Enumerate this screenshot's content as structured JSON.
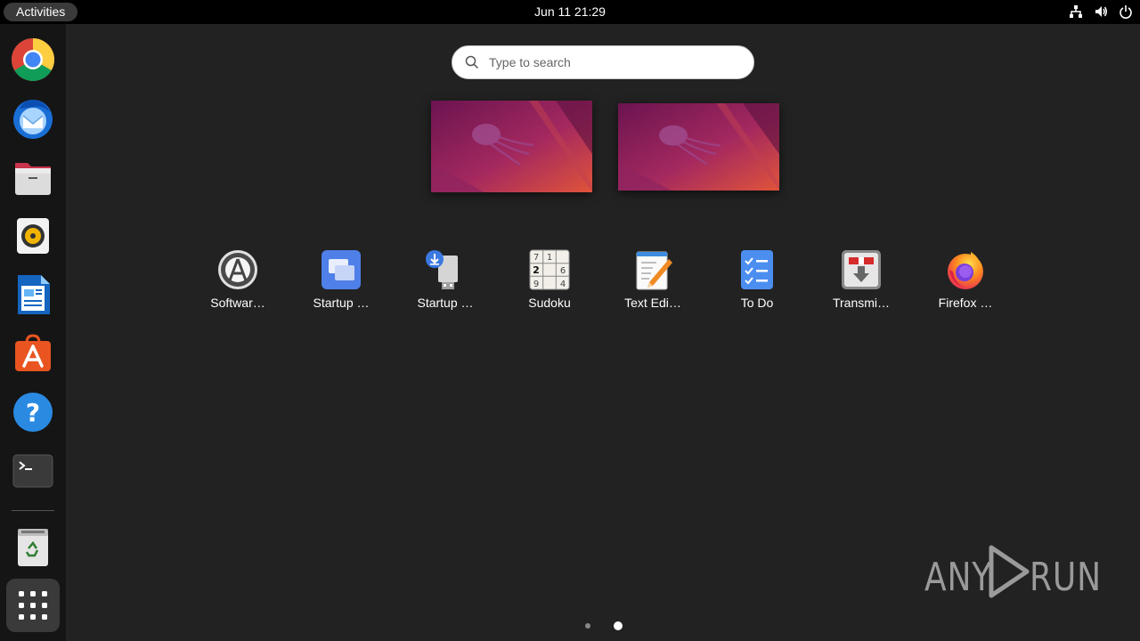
{
  "topbar": {
    "activities_label": "Activities",
    "clock": "Jun 11  21:29",
    "tray_icons": [
      "network-icon",
      "volume-icon",
      "power-icon"
    ]
  },
  "search": {
    "placeholder": "Type to search"
  },
  "dock": {
    "items": [
      {
        "name": "Google Chrome",
        "icon": "chrome-icon"
      },
      {
        "name": "Thunderbird Mail",
        "icon": "thunderbird-icon"
      },
      {
        "name": "Files",
        "icon": "files-icon"
      },
      {
        "name": "Rhythmbox",
        "icon": "rhythmbox-icon"
      },
      {
        "name": "LibreOffice Writer",
        "icon": "writer-icon"
      },
      {
        "name": "Ubuntu Software",
        "icon": "app-center-icon"
      },
      {
        "name": "Help",
        "icon": "help-icon"
      },
      {
        "name": "Terminal",
        "icon": "terminal-icon"
      },
      {
        "name": "Trash",
        "icon": "trash-icon"
      },
      {
        "name": "Show Applications",
        "icon": "app-grid-icon"
      }
    ]
  },
  "workspaces": [
    "workspace-1",
    "workspace-2"
  ],
  "apps": [
    {
      "label": "Softwar…",
      "icon": "software-updater-icon"
    },
    {
      "label": "Startup …",
      "icon": "startup-applications-icon"
    },
    {
      "label": "Startup …",
      "icon": "startup-disk-creator-icon"
    },
    {
      "label": "Sudoku",
      "icon": "sudoku-icon"
    },
    {
      "label": "Text Edi…",
      "icon": "text-editor-icon"
    },
    {
      "label": "To Do",
      "icon": "todo-icon"
    },
    {
      "label": "Transmi…",
      "icon": "transmission-icon"
    },
    {
      "label": "Firefox …",
      "icon": "firefox-icon"
    }
  ],
  "pagination": {
    "pages": 2,
    "current": 2
  },
  "watermark": {
    "left": "ANY",
    "right": "RUN"
  },
  "sudoku_digits": [
    "7",
    "1",
    "2",
    "6",
    "9",
    "4"
  ],
  "colors": {
    "background": "#222222",
    "dock": "#151515",
    "topbar": "#000000",
    "accent_orange": "#e95420",
    "wallpaper_purple": "#7a1d5e"
  }
}
